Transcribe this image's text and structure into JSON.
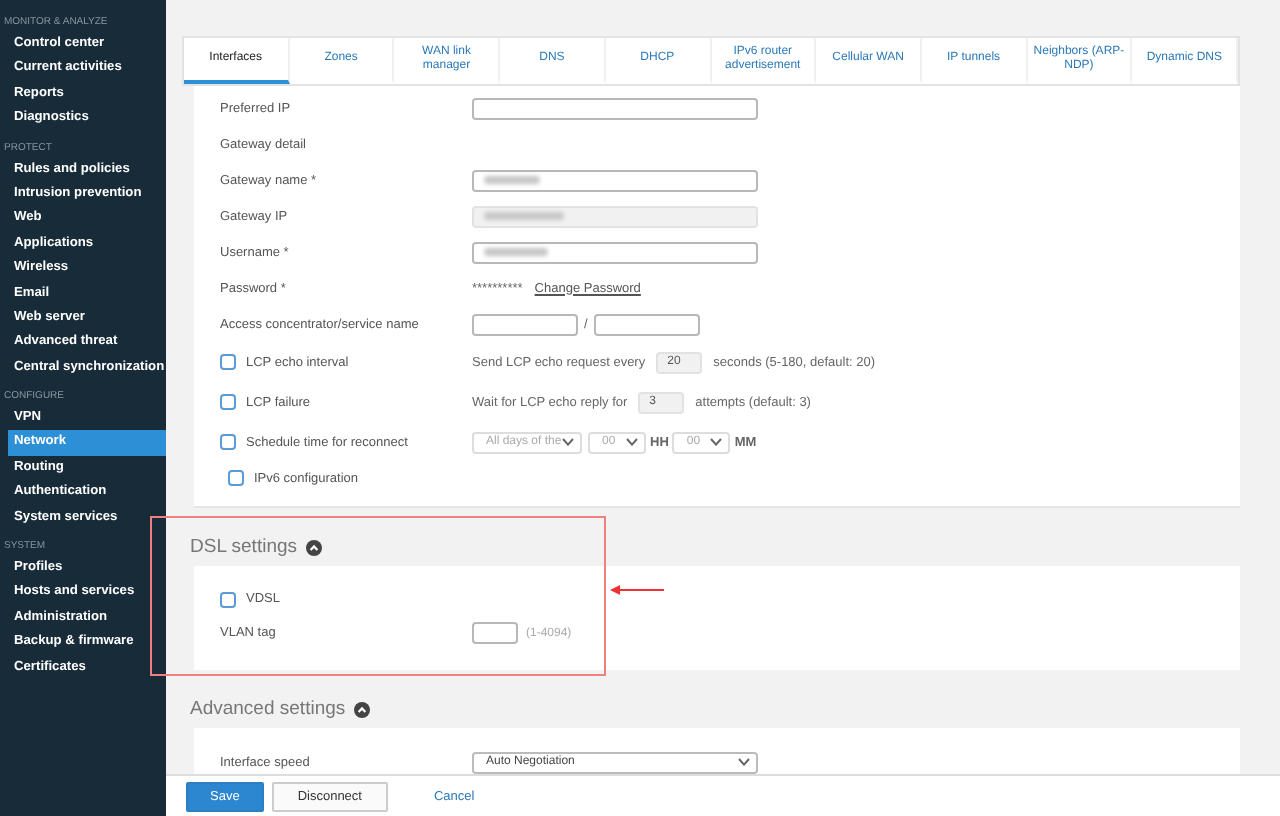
{
  "sidebar": {
    "sections": [
      {
        "heading": "MONITOR & ANALYZE",
        "items": [
          {
            "label": "Control center",
            "selected": false
          },
          {
            "label": "Current activities",
            "selected": false
          },
          {
            "label": "Reports",
            "selected": false
          },
          {
            "label": "Diagnostics",
            "selected": false
          }
        ]
      },
      {
        "heading": "PROTECT",
        "items": [
          {
            "label": "Rules and policies",
            "selected": false
          },
          {
            "label": "Intrusion prevention",
            "selected": false
          },
          {
            "label": "Web",
            "selected": false
          },
          {
            "label": "Applications",
            "selected": false
          },
          {
            "label": "Wireless",
            "selected": false
          },
          {
            "label": "Email",
            "selected": false
          },
          {
            "label": "Web server",
            "selected": false
          },
          {
            "label": "Advanced threat",
            "selected": false
          },
          {
            "label": "Central synchronization",
            "selected": false
          }
        ]
      },
      {
        "heading": "CONFIGURE",
        "items": [
          {
            "label": "VPN",
            "selected": false
          },
          {
            "label": "Network",
            "selected": true
          },
          {
            "label": "Routing",
            "selected": false
          },
          {
            "label": "Authentication",
            "selected": false
          },
          {
            "label": "System services",
            "selected": false
          }
        ]
      },
      {
        "heading": "SYSTEM",
        "items": [
          {
            "label": "Profiles",
            "selected": false
          },
          {
            "label": "Hosts and services",
            "selected": false
          },
          {
            "label": "Administration",
            "selected": false
          },
          {
            "label": "Backup & firmware",
            "selected": false
          },
          {
            "label": "Certificates",
            "selected": false
          }
        ]
      }
    ]
  },
  "tabs": [
    {
      "label": "Interfaces",
      "selected": true
    },
    {
      "label": "Zones",
      "selected": false
    },
    {
      "label": "WAN link manager",
      "selected": false
    },
    {
      "label": "DNS",
      "selected": false
    },
    {
      "label": "DHCP",
      "selected": false
    },
    {
      "label": "IPv6 router advertisement",
      "selected": false
    },
    {
      "label": "Cellular WAN",
      "selected": false
    },
    {
      "label": "IP tunnels",
      "selected": false
    },
    {
      "label": "Neighbors (ARP-NDP)",
      "selected": false
    },
    {
      "label": "Dynamic DNS",
      "selected": false
    }
  ],
  "interface_form": {
    "rows": [
      {
        "kind": "input",
        "label": "Preferred IP",
        "redacted": false,
        "disabled": false
      },
      {
        "kind": "heading",
        "label": "Gateway detail"
      },
      {
        "kind": "input",
        "label": "Gateway name *",
        "redacted": true,
        "disabled": false
      },
      {
        "kind": "input",
        "label": "Gateway IP",
        "redacted": true,
        "disabled": true
      },
      {
        "kind": "input",
        "label": "Username *",
        "redacted": true,
        "disabled": false
      },
      {
        "kind": "password",
        "label": "Password *",
        "mask": "**********",
        "link": "Change Password"
      },
      {
        "kind": "pair",
        "label": "Access concentrator/service name",
        "separator": "/"
      },
      {
        "kind": "check",
        "label": "LCP echo interval",
        "checked": false,
        "prefix": "Send LCP echo request every",
        "value": "20",
        "suffix": "seconds (5-180, default: 20)"
      },
      {
        "kind": "check",
        "label": "LCP failure",
        "checked": false,
        "prefix": "Wait for LCP echo reply for",
        "value": "3",
        "suffix": "attempts (default: 3)"
      },
      {
        "kind": "schedule",
        "label": "Schedule time for reconnect",
        "checked": false,
        "day": "All days of the",
        "hour": "00",
        "hour_unit": "HH",
        "minute": "00",
        "minute_unit": "MM"
      },
      {
        "kind": "subcheck",
        "label": "IPv6 configuration",
        "checked": false
      }
    ]
  },
  "dsl_settings": {
    "title": "DSL settings",
    "expanded": true,
    "vdsl": {
      "label": "VDSL",
      "checked": false
    },
    "vlan_tag": {
      "label": "VLAN tag",
      "hint": "(1-4094)"
    }
  },
  "advanced_settings": {
    "title": "Advanced settings",
    "expanded": true,
    "interface_speed": {
      "label": "Interface speed",
      "value": "Auto Negotiation"
    }
  },
  "buttons": [
    {
      "label": "Save",
      "kind": "primary"
    },
    {
      "label": "Disconnect",
      "kind": "secondary"
    },
    {
      "label": "Cancel",
      "kind": "link"
    }
  ]
}
